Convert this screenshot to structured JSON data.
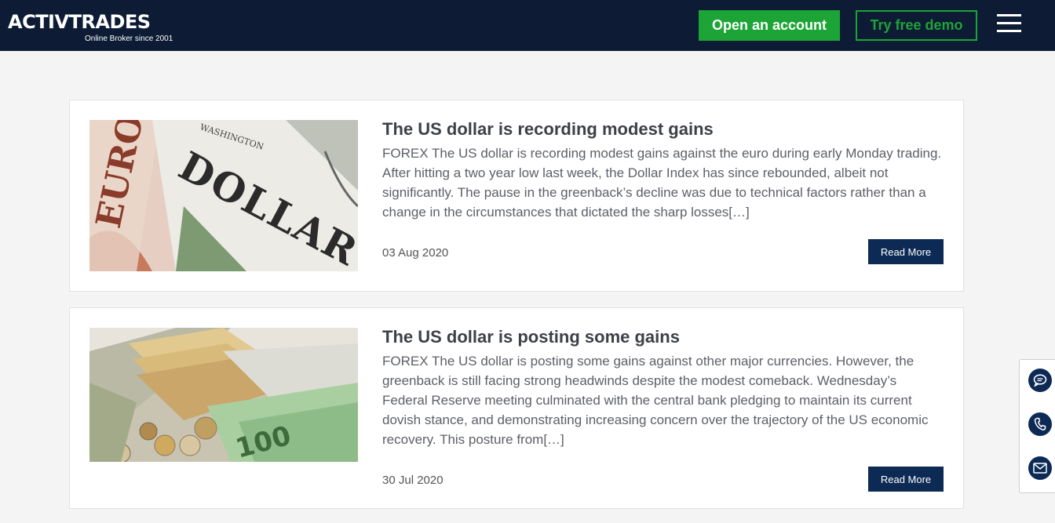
{
  "brand": {
    "name": "ACTIVTRADES",
    "tagline": "Online Broker since 2001"
  },
  "header": {
    "open_account": "Open an account",
    "free_demo": "Try free demo"
  },
  "articles": [
    {
      "title": "The US dollar is recording modest gains",
      "excerpt": "FOREX The US dollar is recording modest gains against the euro during early Monday trading. After hitting a two year low last week, the Dollar Index has since rebounded, albeit not significantly. The pause in the greenback’s decline was due to technical factors rather than a change in the circumstances that dictated the sharp losses[…]",
      "date": "03 Aug 2020",
      "read_more": "Read More"
    },
    {
      "title": "The US dollar is posting some gains",
      "excerpt": "FOREX The US dollar is posting some gains against other major currencies. However, the greenback is still facing strong headwinds despite the modest comeback. Wednesday’s Federal Reserve meeting culminated with the central bank pledging to maintain its current dovish stance, and demonstrating increasing concern over the trajectory of the US economic recovery. This posture from[…]",
      "date": "30 Jul 2020",
      "read_more": "Read More"
    }
  ],
  "side_contact": {
    "icons": [
      "chat-icon",
      "phone-icon",
      "email-icon"
    ]
  },
  "colors": {
    "header_bg": "#0d1b35",
    "accent_green": "#1ca536",
    "button_navy": "#0d2a55",
    "page_bg": "#f4f4f4"
  }
}
